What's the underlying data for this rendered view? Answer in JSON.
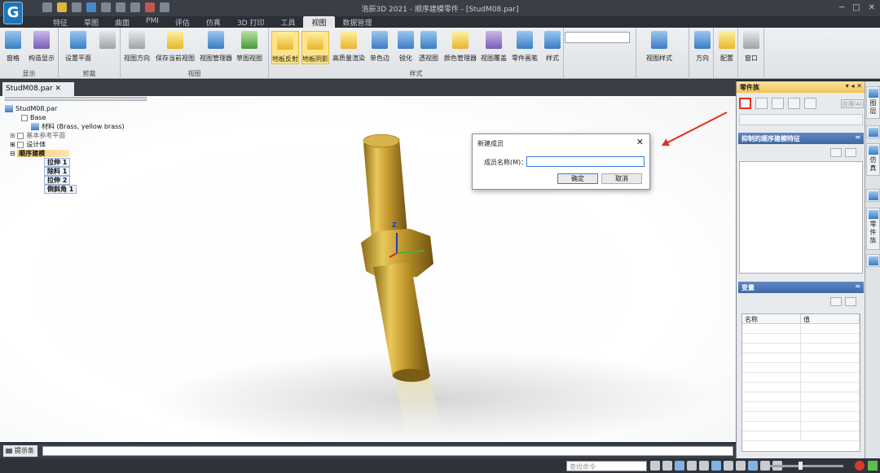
{
  "app": {
    "title": "浩辰3D 2021 - 顺序建模零件 - [StudM08.par]",
    "logo_letter": "G"
  },
  "ribbon_tabs": [
    "特征",
    "草图",
    "曲面",
    "PMI",
    "评估",
    "仿真",
    "3D 打印",
    "工具",
    "视图",
    "数据管理"
  ],
  "active_tab": "视图",
  "ribbon": {
    "groups": [
      {
        "label": "显示",
        "buttons": [
          "窗格",
          "构造显示"
        ]
      },
      {
        "label": "剪裁",
        "buttons": [
          "设置平面"
        ]
      },
      {
        "label": "视图",
        "buttons": [
          "视图方向",
          "保存当前视图",
          "视图管理器",
          "草图视图"
        ]
      },
      {
        "label": "样式",
        "buttons": [
          "地板反射",
          "地板阴影",
          "高质量渲染",
          "单色边",
          "锐化",
          "透视图",
          "颜色管理器",
          "视图覆盖",
          "零件画笔",
          "样式"
        ]
      },
      {
        "label": "",
        "buttons": [
          "视图样式"
        ]
      },
      {
        "label": "",
        "buttons": [
          "方向"
        ]
      },
      {
        "label": "",
        "buttons": [
          "配置"
        ]
      },
      {
        "label": "",
        "buttons": [
          "窗口"
        ]
      }
    ]
  },
  "doc_tab": "StudM08.par",
  "tree": {
    "root": "StudM08.par",
    "base": "Base",
    "material": "材料 (Brass, yellow brass)",
    "ref_planes": "基本参考平面",
    "design_body": "设计体",
    "sequential": "顺序建模",
    "features": [
      "拉伸 1",
      "除料 1",
      "拉伸 2",
      "倒斜角 1"
    ]
  },
  "axis": {
    "z": "Z"
  },
  "dialog": {
    "title": "新建成员",
    "close": "✕",
    "label": "成员名称(M)：",
    "value": "",
    "ok": "确定",
    "cancel": "取消"
  },
  "panel": {
    "title": "零件族",
    "controls": "▾ ◂ ✕",
    "apply_button": "应用(A)",
    "section1": "抑制的顺序建模特征",
    "section2": "变量",
    "chevron": "≈",
    "columns": [
      "名称",
      "值"
    ]
  },
  "vtabs": [
    "图层",
    "仿真",
    "零件族"
  ],
  "cmd": {
    "label": "提示条"
  },
  "status": {
    "search_placeholder": "查找命令"
  }
}
